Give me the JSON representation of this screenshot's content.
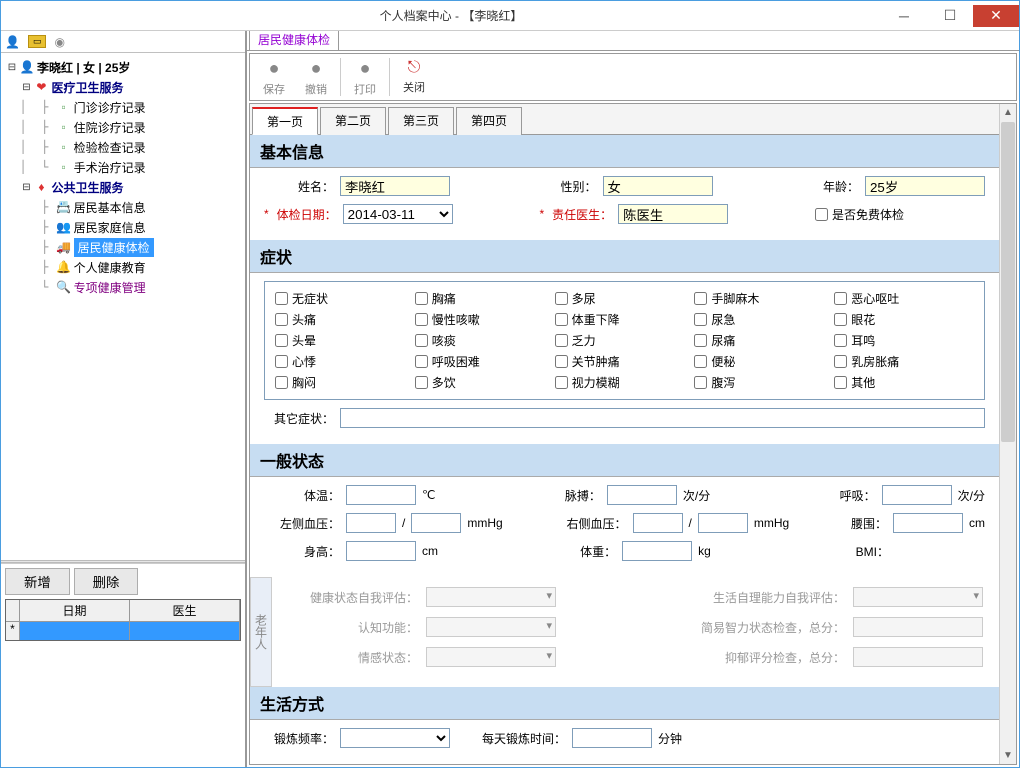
{
  "window": {
    "title": "个人档案中心 - 【李晓红】"
  },
  "tree": {
    "root": "李晓红  |  女  |  25岁",
    "medical": "医疗卫生服务",
    "medical_items": [
      "门诊诊疗记录",
      "住院诊疗记录",
      "检验检查记录",
      "手术治疗记录"
    ],
    "public": "公共卫生服务",
    "public_items": [
      "居民基本信息",
      "居民家庭信息",
      "居民健康体检",
      "个人健康教育",
      "专项健康管理"
    ]
  },
  "sidebar_btns": {
    "new": "新增",
    "del": "删除"
  },
  "grid": {
    "col1": "日期",
    "col2": "医生"
  },
  "main_tab": "居民健康体检",
  "toolbar": {
    "save": "保存",
    "undo": "撤销",
    "print": "打印",
    "close": "关闭"
  },
  "page_tabs": [
    "第一页",
    "第二页",
    "第三页",
    "第四页"
  ],
  "sections": {
    "basic": "基本信息",
    "symptoms": "症状",
    "general": "一般状态",
    "lifestyle": "生活方式"
  },
  "basic": {
    "name_lbl": "姓名：",
    "name": "李晓红",
    "sex_lbl": "性别：",
    "sex": "女",
    "age_lbl": "年龄：",
    "age": "25岁",
    "date_lbl": "体检日期：",
    "date": "2014-03-11",
    "doctor_lbl": "责任医生：",
    "doctor": "陈医生",
    "free_lbl": "是否免费体检"
  },
  "symptoms_list": [
    "无症状",
    "胸痛",
    "多尿",
    "手脚麻木",
    "恶心呕吐",
    "头痛",
    "慢性咳嗽",
    "体重下降",
    "尿急",
    "眼花",
    "头晕",
    "咳痰",
    "乏力",
    "尿痛",
    "耳鸣",
    "心悸",
    "呼吸困难",
    "关节肿痛",
    "便秘",
    "乳房胀痛",
    "胸闷",
    "多饮",
    "视力模糊",
    "腹泻",
    "其他"
  ],
  "other_symptom_lbl": "其它症状：",
  "general": {
    "temp": "体温：",
    "temp_unit": "℃",
    "pulse": "脉搏：",
    "pulse_unit": "次/分",
    "breath": "呼吸：",
    "breath_unit": "次/分",
    "lbp": "左侧血压：",
    "rbp": "右侧血压：",
    "bp_unit": "mmHg",
    "slash": "/",
    "waist": "腰围：",
    "cm": "cm",
    "height": "身高：",
    "weight": "体重：",
    "kg": "kg",
    "bmi": "BMI："
  },
  "elderly": {
    "title": "老年人",
    "health": "健康状态自我评估：",
    "life": "生活自理能力自我评估：",
    "cog": "认知功能：",
    "iq": "简易智力状态检查，总分：",
    "emo": "情感状态：",
    "dep": "抑郁评分检查，总分："
  },
  "lifestyle": {
    "freq": "锻炼频率：",
    "daily": "每天锻炼时间：",
    "min": "分钟"
  }
}
